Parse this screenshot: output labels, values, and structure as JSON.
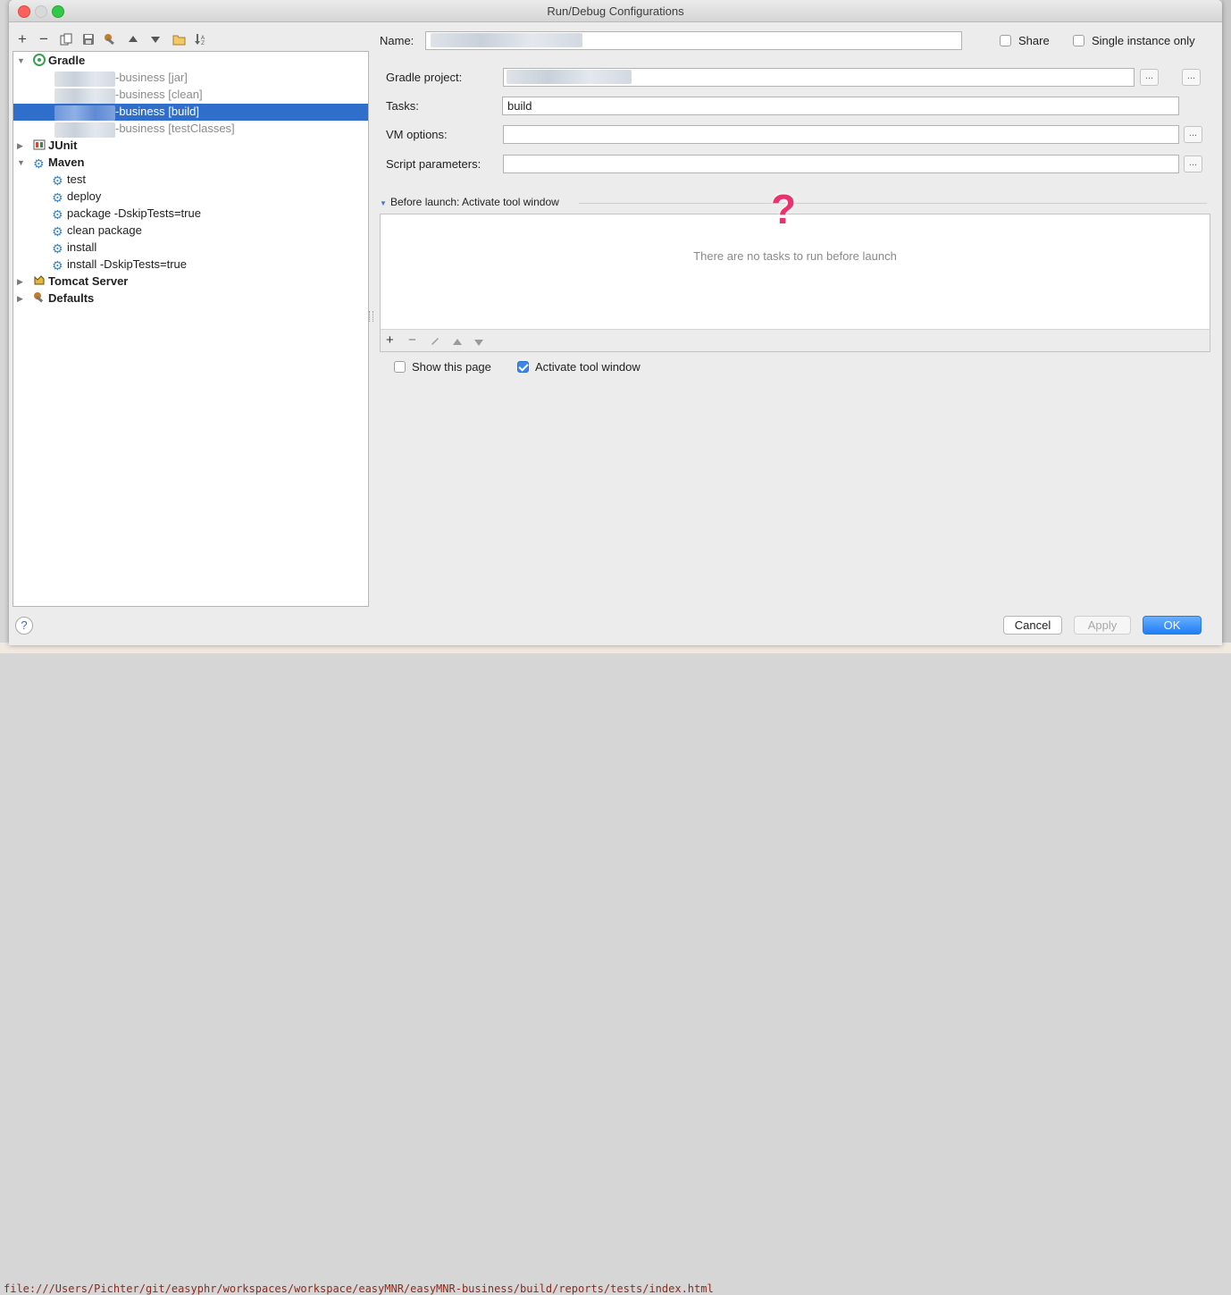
{
  "window": {
    "title": "Run/Debug Configurations"
  },
  "background_path": "file:///Users/Pichter/git/easyphr/workspaces/workspace/easyMNR/easyMNR-business/build/reports/tests/index.html",
  "toolbar": {
    "icons": [
      "add-icon",
      "remove-icon",
      "copy-icon",
      "save-icon",
      "wrench-icon",
      "move-up-icon",
      "move-down-icon",
      "folder-icon",
      "sort-icon"
    ],
    "add": "+",
    "remove": "−"
  },
  "tree": {
    "gradle": {
      "label": "Gradle",
      "items": [
        {
          "label": "-business [jar]"
        },
        {
          "label": "-business [clean]"
        },
        {
          "label": "-business [build]",
          "selected": true
        },
        {
          "label": "-business [testClasses]"
        }
      ]
    },
    "junit": {
      "label": "JUnit"
    },
    "maven": {
      "label": "Maven",
      "items": [
        {
          "label": "test"
        },
        {
          "label": "deploy"
        },
        {
          "label": "package -DskipTests=true"
        },
        {
          "label": "clean package"
        },
        {
          "label": "install"
        },
        {
          "label": "install  -DskipTests=true"
        }
      ]
    },
    "tomcat": {
      "label": "Tomcat Server"
    },
    "defaults": {
      "label": "Defaults"
    }
  },
  "form": {
    "name_label": "Name:",
    "share_label": "Share",
    "share_checked": false,
    "single_instance_label": "Single instance only",
    "single_instance_checked": false,
    "gradle_project_label": "Gradle project:",
    "tasks_label": "Tasks:",
    "tasks_value": "build",
    "vm_options_label": "VM options:",
    "vm_options_value": "",
    "script_params_label": "Script parameters:",
    "script_params_value": "",
    "ellipsis": "..."
  },
  "before_launch": {
    "header": "Before launch: Activate tool window",
    "empty_text": "There are no tasks to run before launch",
    "annotation": "?",
    "annotation_color": "#e8336d",
    "add": "+",
    "remove": "−",
    "show_this_page_label": "Show this page",
    "show_this_page_checked": false,
    "activate_tool_window_label": "Activate tool window",
    "activate_tool_window_checked": true
  },
  "buttons": {
    "help": "?",
    "cancel": "Cancel",
    "apply": "Apply",
    "ok": "OK"
  },
  "colors": {
    "selection": "#2f6fcb",
    "ok_button": "#1f7ef5",
    "checkbox_checked": "#3b86e8"
  }
}
